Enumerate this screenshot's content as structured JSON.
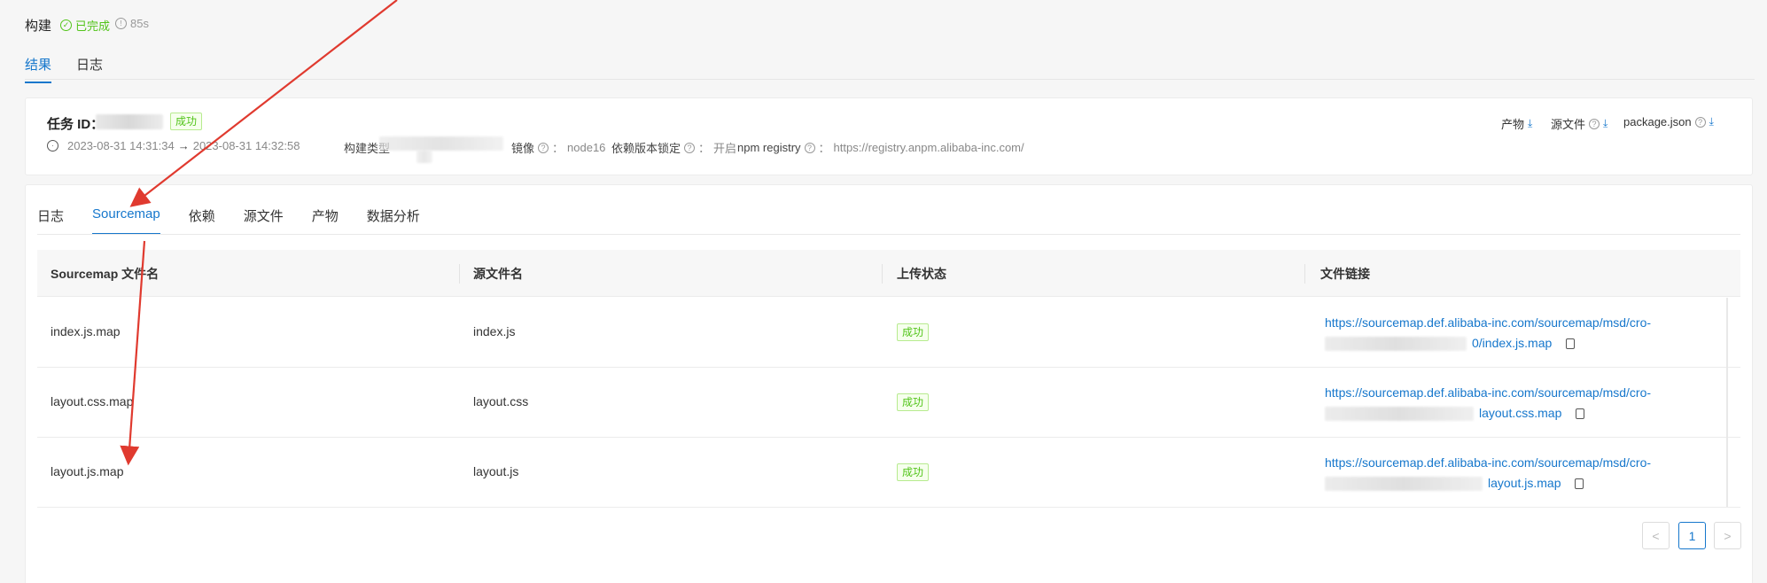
{
  "header": {
    "title": "构建",
    "status": "已完成",
    "duration": "85s"
  },
  "top_tabs": [
    {
      "label": "结果",
      "active": true
    },
    {
      "label": "日志",
      "active": false
    }
  ],
  "info": {
    "task_id_label": "任务 ID：",
    "status_badge": "成功",
    "start_time": "2023-08-31 14:31:34",
    "arrow": "→",
    "end_time": "2023-08-31 14:32:58",
    "build_type_label": "构建类型",
    "image_label": "镜像",
    "image_value": "node16",
    "lock_label": "依赖版本锁定",
    "lock_value": "开启",
    "registry_label": "npm registry",
    "registry_value": "https://registry.anpm.alibaba-inc.com/",
    "colon": "："
  },
  "downloads": [
    {
      "label": "产物",
      "has_help": false
    },
    {
      "label": "源文件",
      "has_help": true
    },
    {
      "label": "package.json",
      "has_help": true
    }
  ],
  "sub_tabs": [
    {
      "label": "日志",
      "active": false
    },
    {
      "label": "Sourcemap",
      "active": true
    },
    {
      "label": "依赖",
      "active": false
    },
    {
      "label": "源文件",
      "active": false
    },
    {
      "label": "产物",
      "active": false
    },
    {
      "label": "数据分析",
      "active": false
    }
  ],
  "table": {
    "columns": [
      "Sourcemap 文件名",
      "源文件名",
      "上传状态",
      "文件链接"
    ],
    "rows": [
      {
        "map_file": "index.js.map",
        "source_file": "index.js",
        "status": "成功",
        "link_line1": "https://sourcemap.def.alibaba-inc.com/sourcemap/msd/cro-",
        "link_line2_tail": "0/index.js.map"
      },
      {
        "map_file": "layout.css.map",
        "source_file": "layout.css",
        "status": "成功",
        "link_line1": "https://sourcemap.def.alibaba-inc.com/sourcemap/msd/cro-",
        "link_line2_tail": "layout.css.map"
      },
      {
        "map_file": "layout.js.map",
        "source_file": "layout.js",
        "status": "成功",
        "link_line1": "https://sourcemap.def.alibaba-inc.com/sourcemap/msd/cro-",
        "link_line2_tail": "layout.js.map"
      }
    ]
  },
  "pagination": {
    "prev": "<",
    "current": "1",
    "next": ">"
  },
  "colors": {
    "accent": "#1677cc",
    "success": "#52c41a",
    "annotation": "#e03a2f"
  }
}
